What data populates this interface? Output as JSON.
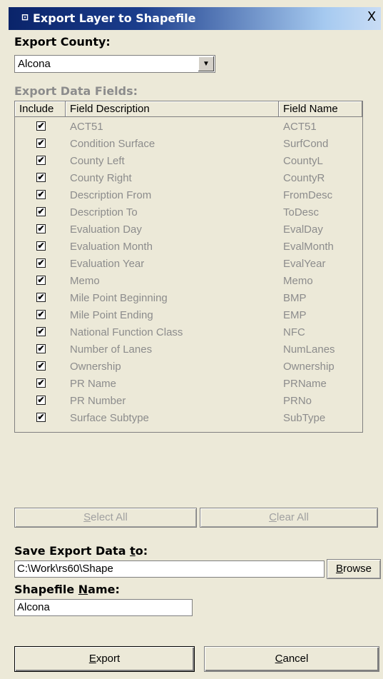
{
  "window": {
    "title": "Export Layer to Shapefile",
    "close_label": "X"
  },
  "county": {
    "label": "Export County:",
    "value": "Alcona"
  },
  "fields": {
    "label": "Export Data Fields:",
    "columns": [
      "Include",
      "Field Description",
      "Field Name"
    ],
    "rows": [
      {
        "desc": "ACT51",
        "name": "ACT51"
      },
      {
        "desc": "Condition Surface",
        "name": "SurfCond"
      },
      {
        "desc": "County Left",
        "name": "CountyL"
      },
      {
        "desc": "County Right",
        "name": "CountyR"
      },
      {
        "desc": "Description From",
        "name": "FromDesc"
      },
      {
        "desc": "Description To",
        "name": "ToDesc"
      },
      {
        "desc": "Evaluation Day",
        "name": "EvalDay"
      },
      {
        "desc": "Evaluation Month",
        "name": "EvalMonth"
      },
      {
        "desc": "Evaluation Year",
        "name": "EvalYear"
      },
      {
        "desc": "Memo",
        "name": "Memo"
      },
      {
        "desc": "Mile Point Beginning",
        "name": "BMP"
      },
      {
        "desc": "Mile Point Ending",
        "name": "EMP"
      },
      {
        "desc": "National Function Class",
        "name": "NFC"
      },
      {
        "desc": "Number of Lanes",
        "name": "NumLanes"
      },
      {
        "desc": "Ownership",
        "name": "Ownership"
      },
      {
        "desc": "PR Name",
        "name": "PRName"
      },
      {
        "desc": "PR Number",
        "name": "PRNo"
      },
      {
        "desc": "Surface Subtype",
        "name": "SubType"
      }
    ]
  },
  "buttons": {
    "select_all": {
      "pre": "",
      "key": "S",
      "post": "elect All"
    },
    "clear_all": {
      "pre": "",
      "key": "C",
      "post": "lear All"
    },
    "browse": {
      "pre": "",
      "key": "B",
      "post": "rowse"
    },
    "export": {
      "pre": "",
      "key": "E",
      "post": "xport"
    },
    "cancel": {
      "pre": "",
      "key": "C",
      "post": "ancel"
    }
  },
  "save": {
    "label_pre": "Save Export Data ",
    "label_key": "t",
    "label_post": "o:",
    "value": "C:\\Work\\rs60\\Shape"
  },
  "shapefile": {
    "label_pre": "Shapefile ",
    "label_key": "N",
    "label_post": "ame:",
    "value": "Alcona"
  }
}
